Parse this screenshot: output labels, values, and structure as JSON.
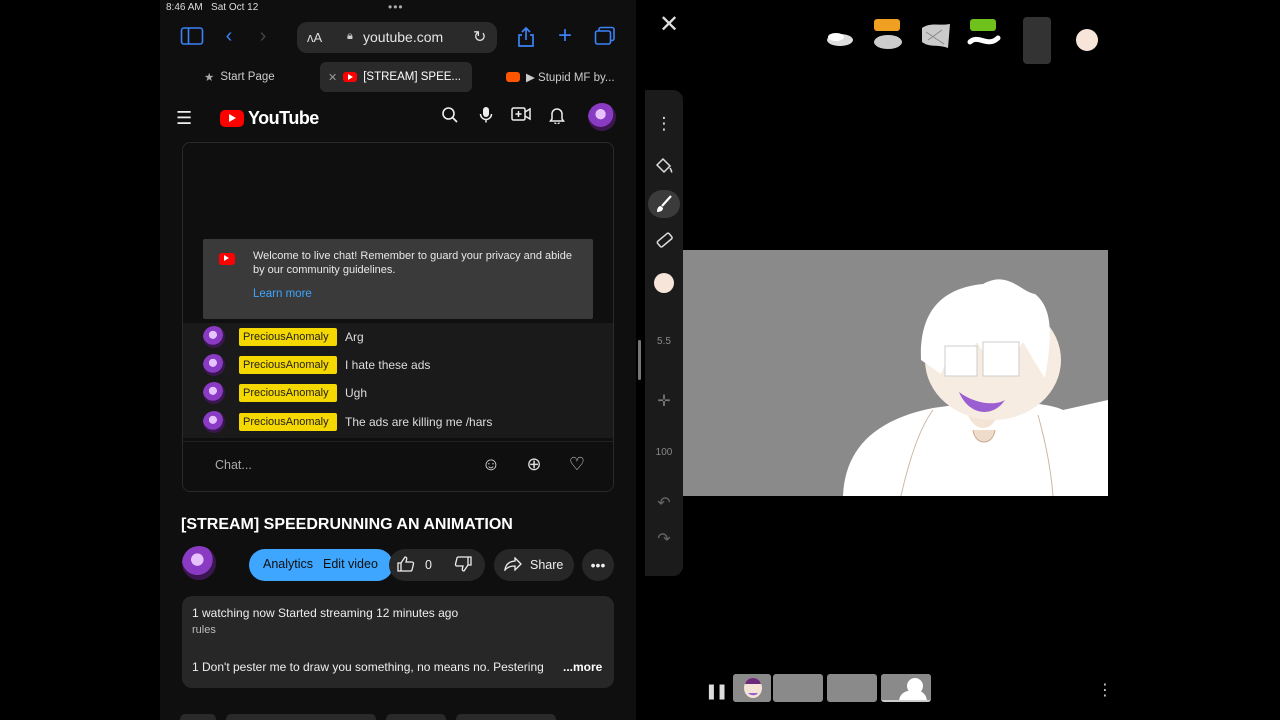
{
  "status_bar": {
    "time": "8:46 AM",
    "date": "Sat Oct 12"
  },
  "safari": {
    "text_size_label": "ʌA",
    "url": "youtube.com",
    "tabs": [
      {
        "label": "Start Page"
      },
      {
        "label": "[STREAM] SPEE..."
      },
      {
        "label": "▶ Stupid MF by..."
      }
    ]
  },
  "youtube": {
    "logo_text": "YouTube",
    "chat": {
      "welcome_text": "Welcome to live chat! Remember to guard your privacy and abide by our community guidelines.",
      "learn_more": "Learn more",
      "messages": [
        {
          "author": "PreciousAnomaly",
          "text": "Arg"
        },
        {
          "author": "PreciousAnomaly",
          "text": "I hate these ads"
        },
        {
          "author": "PreciousAnomaly",
          "text": "Ugh"
        },
        {
          "author": "PreciousAnomaly",
          "text": "The ads are killing me /hars"
        }
      ],
      "input_placeholder": "Chat..."
    },
    "video": {
      "title": "[STREAM] SPEEDRUNNING AN ANIMATION",
      "analytics_label": "Analytics",
      "edit_label": "Edit video",
      "like_count": "0",
      "share_label": "Share",
      "watching": "1 watching now  Started streaming 12 minutes ago",
      "desc_line2": "rules",
      "desc_line3": "1  Don't pester me to draw you something, no means no. Pestering",
      "more_label": "...more"
    }
  },
  "animation_app": {
    "brush_size": "5.5",
    "opacity": "100",
    "accent_color": "#f8e5d9",
    "canvas_bg": "#8a8a8a"
  }
}
